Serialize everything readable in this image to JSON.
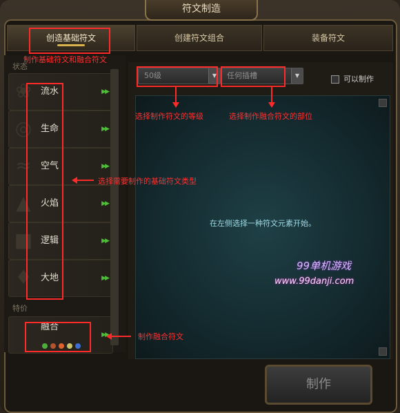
{
  "window": {
    "title": "符文制造"
  },
  "tabs": [
    {
      "label": "创造基础符文",
      "active": true
    },
    {
      "label": "创建符文组合",
      "active": false
    },
    {
      "label": "装备符文",
      "active": false
    }
  ],
  "left": {
    "section_state": "状态",
    "section_special": "特价",
    "runes": [
      {
        "label": "流水",
        "icon": "water-icon"
      },
      {
        "label": "生命",
        "icon": "life-icon"
      },
      {
        "label": "空气",
        "icon": "air-icon"
      },
      {
        "label": "火焰",
        "icon": "fire-icon"
      },
      {
        "label": "逻辑",
        "icon": "logic-icon"
      },
      {
        "label": "大地",
        "icon": "earth-icon"
      }
    ],
    "fusion": {
      "label": "融合"
    }
  },
  "right": {
    "level_dropdown": "50级",
    "slot_dropdown": "任何插槽",
    "checkbox_label": "可以制作",
    "message": "在左侧选择一种符文元素开始。"
  },
  "make_button": "制作",
  "annotations": {
    "tab_note": "制作基础符文和融合符文",
    "level_note": "选择制作符文的等级",
    "slot_note": "选择制作融合符文的部位",
    "type_note": "选择需要制作的基础符文类型",
    "fusion_note": "制作融合符文"
  },
  "watermark": {
    "line1": "99单机游戏",
    "line2": "www.99danji.com"
  },
  "colors": {
    "annotation": "#ff2b2b",
    "accent": "#d9b34c"
  }
}
